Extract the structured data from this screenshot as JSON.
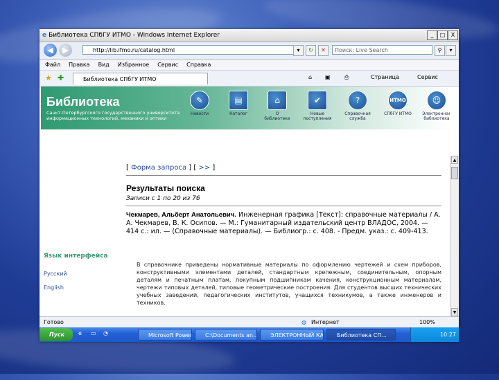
{
  "window": {
    "title": "Библиотека СПбГУ ИТМО - Windows Internet Explorer",
    "min": "_",
    "max": "□",
    "close": "X"
  },
  "address": {
    "url": "http://lib.ifmo.ru/catalog.html"
  },
  "search": {
    "placeholder": "Поиск: Live Search"
  },
  "menu": [
    "Файл",
    "Правка",
    "Вид",
    "Избранное",
    "Сервис",
    "Справка"
  ],
  "tab": {
    "label": "Библиотека СПбГУ ИТМО"
  },
  "commands": {
    "page": "Страница",
    "tools": "Сервис"
  },
  "banner": {
    "title": "Библиотека",
    "subtitle": "Санкт-Петербургского государственного университета информационных технологий, механики и оптики"
  },
  "nav": [
    {
      "label": "Новости"
    },
    {
      "label": "Каталог"
    },
    {
      "label": "О библиотеке"
    },
    {
      "label": "Новые поступления"
    },
    {
      "label": "Справочная служба"
    },
    {
      "label": "СПбГУ ИТМО"
    },
    {
      "label": "Электронная библиотека"
    }
  ],
  "crumbs": {
    "form": "Форма запроса",
    "next": ">>"
  },
  "results": {
    "title": "Результаты поиска",
    "records": "Записи с 1 по 20 из 76"
  },
  "entry": {
    "author": "Чекмарев, Альберт Анатольевич.",
    "text": "Инженерная графика [Текст]: справочные материалы / А. А. Чекмарев, В. К. Осипов. — М.: Гуманитарный издательский центр ВЛАДОС, 2004. — 414 с.: ил. — (Справочные материалы). — Библиогр.: с. 408. - Предм. указ.: с. 409-413.",
    "annotation": "В справочнике приведены нормативные материалы по оформлению чертежей и схем приборов, конструктивными элементами деталей, стандартным крепежным, соединительным, опорным деталям и печатным платам, покупным подшипникам качения, конструкционным материалам, чертежи типовых деталей, типовые геометрические построения. Для студентов высших технических учебных заведений, педагогических институтов, учащихся техникумов, а также инженеров и техников."
  },
  "language": {
    "heading": "Язык интерфейса",
    "options": [
      "Русский",
      "English"
    ]
  },
  "status": {
    "left": "Готово",
    "zone": "Интернет",
    "zoom": "100%"
  },
  "taskbar": {
    "start": "Пуск",
    "tasks": [
      "Microsoft Power...",
      "C:\\Documents an...",
      "ЭЛЕКТРОННЫЙ КАТ...",
      "Библиотека СП..."
    ],
    "time": "10:27"
  }
}
